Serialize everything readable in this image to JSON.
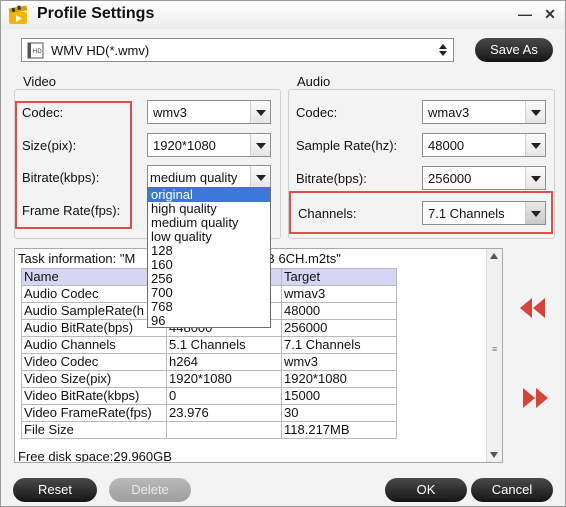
{
  "window": {
    "title": "Profile Settings",
    "minimize": "—",
    "close": "✕"
  },
  "profile": {
    "value": "WMV HD(*.wmv)",
    "save_as": "Save As"
  },
  "video": {
    "group_title": "Video",
    "codec_label": "Codec:",
    "codec_value": "wmv3",
    "size_label": "Size(pix):",
    "size_value": "1920*1080",
    "bitrate_label": "Bitrate(kbps):",
    "bitrate_value": "medium quality",
    "framerate_label": "Frame Rate(fps):",
    "bitrate_options": [
      "original",
      "high quality",
      "medium quality",
      "low quality",
      "128",
      "160",
      "256",
      "700",
      "768",
      "96"
    ],
    "bitrate_selected_index": 0
  },
  "audio": {
    "group_title": "Audio",
    "codec_label": "Codec:",
    "codec_value": "wmav3",
    "samplerate_label": "Sample Rate(hz):",
    "samplerate_value": "48000",
    "bitrate_label": "Bitrate(bps):",
    "bitrate_value": "256000",
    "channels_label": "Channels:",
    "channels_value": "7.1 Channels"
  },
  "task": {
    "info_prefix": "Task information: \"M",
    "info_suffix": "MB 6CH.m2ts\"",
    "columns": [
      "Name",
      "",
      "Target"
    ],
    "rows": [
      [
        "Audio Codec",
        "",
        "wmav3"
      ],
      [
        "Audio SampleRate(h",
        "",
        "48000"
      ],
      [
        "Audio BitRate(bps)",
        "448000",
        "256000"
      ],
      [
        "Audio Channels",
        "5.1 Channels",
        "7.1 Channels"
      ],
      [
        "Video Codec",
        "h264",
        "wmv3"
      ],
      [
        "Video Size(pix)",
        "1920*1080",
        "1920*1080"
      ],
      [
        "Video BitRate(kbps)",
        "0",
        "15000"
      ],
      [
        "Video FrameRate(fps)",
        "23.976",
        "30"
      ],
      [
        "File Size",
        "",
        "118.217MB"
      ]
    ],
    "free_disk": "Free disk space:29.960GB"
  },
  "buttons": {
    "reset": "Reset",
    "delete": "Delete",
    "ok": "OK",
    "cancel": "Cancel"
  },
  "colors": {
    "accent_red": "#e0504a",
    "highlight_blue": "#3b78d8",
    "header_row": "#d6d6f4"
  }
}
